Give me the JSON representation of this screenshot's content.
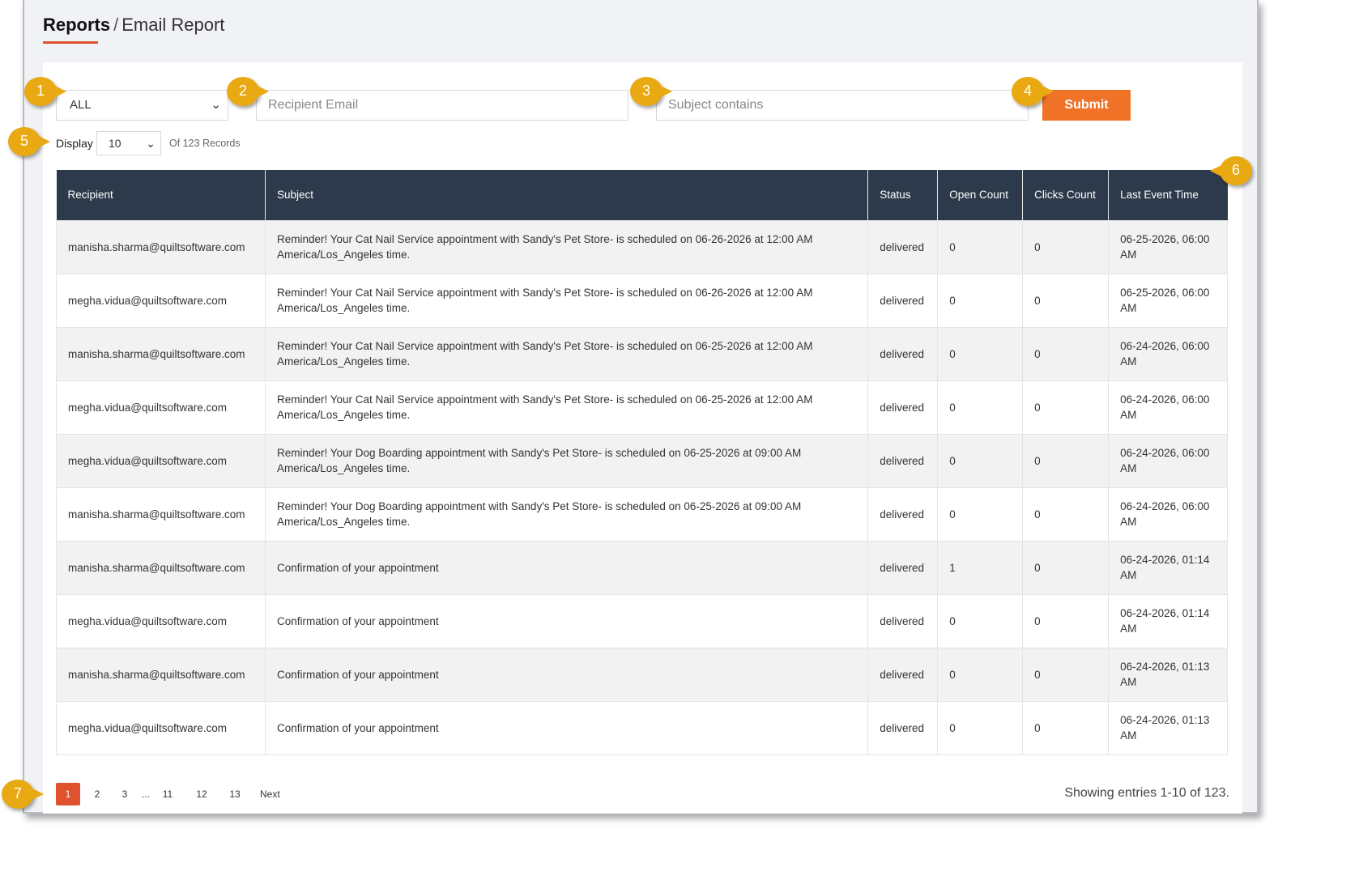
{
  "breadcrumb": {
    "parent": "Reports",
    "separator": "/",
    "current": "Email Report"
  },
  "filters": {
    "status_select": "ALL",
    "recipient_placeholder": "Recipient Email",
    "subject_placeholder": "Subject contains",
    "submit_label": "Submit"
  },
  "display": {
    "label": "Display",
    "page_size": "10",
    "records_text": "Of 123 Records"
  },
  "table": {
    "columns": [
      "Recipient",
      "Subject",
      "Status",
      "Open Count",
      "Clicks Count",
      "Last Event Time"
    ],
    "rows": [
      {
        "recipient": "manisha.sharma@quiltsoftware.com",
        "subject": "Reminder! Your Cat Nail Service appointment with Sandy's Pet Store- is scheduled on 06-26-2026 at 12:00 AM America/Los_Angeles time.",
        "status": "delivered",
        "open": "0",
        "clicks": "0",
        "last": "06-25-2026, 06:00 AM"
      },
      {
        "recipient": "megha.vidua@quiltsoftware.com",
        "subject": "Reminder! Your Cat Nail Service appointment with Sandy's Pet Store- is scheduled on 06-26-2026 at 12:00 AM America/Los_Angeles time.",
        "status": "delivered",
        "open": "0",
        "clicks": "0",
        "last": "06-25-2026, 06:00 AM"
      },
      {
        "recipient": "manisha.sharma@quiltsoftware.com",
        "subject": "Reminder! Your Cat Nail Service appointment with Sandy's Pet Store- is scheduled on 06-25-2026 at 12:00 AM America/Los_Angeles time.",
        "status": "delivered",
        "open": "0",
        "clicks": "0",
        "last": "06-24-2026, 06:00 AM"
      },
      {
        "recipient": "megha.vidua@quiltsoftware.com",
        "subject": "Reminder! Your Cat Nail Service appointment with Sandy's Pet Store- is scheduled on 06-25-2026 at 12:00 AM America/Los_Angeles time.",
        "status": "delivered",
        "open": "0",
        "clicks": "0",
        "last": "06-24-2026, 06:00 AM"
      },
      {
        "recipient": "megha.vidua@quiltsoftware.com",
        "subject": "Reminder! Your Dog Boarding appointment with Sandy's Pet Store- is scheduled on 06-25-2026 at 09:00 AM America/Los_Angeles time.",
        "status": "delivered",
        "open": "0",
        "clicks": "0",
        "last": "06-24-2026, 06:00 AM"
      },
      {
        "recipient": "manisha.sharma@quiltsoftware.com",
        "subject": "Reminder! Your Dog Boarding appointment with Sandy's Pet Store- is scheduled on 06-25-2026 at 09:00 AM America/Los_Angeles time.",
        "status": "delivered",
        "open": "0",
        "clicks": "0",
        "last": "06-24-2026, 06:00 AM"
      },
      {
        "recipient": "manisha.sharma@quiltsoftware.com",
        "subject": "Confirmation of your appointment",
        "status": "delivered",
        "open": "1",
        "clicks": "0",
        "last": "06-24-2026, 01:14 AM"
      },
      {
        "recipient": "megha.vidua@quiltsoftware.com",
        "subject": "Confirmation of your appointment",
        "status": "delivered",
        "open": "0",
        "clicks": "0",
        "last": "06-24-2026, 01:14 AM"
      },
      {
        "recipient": "manisha.sharma@quiltsoftware.com",
        "subject": "Confirmation of your appointment",
        "status": "delivered",
        "open": "0",
        "clicks": "0",
        "last": "06-24-2026, 01:13 AM"
      },
      {
        "recipient": "megha.vidua@quiltsoftware.com",
        "subject": "Confirmation of your appointment",
        "status": "delivered",
        "open": "0",
        "clicks": "0",
        "last": "06-24-2026, 01:13 AM"
      }
    ]
  },
  "pagination": {
    "pages": [
      "1",
      "2",
      "3",
      "...",
      "11",
      "12",
      "13",
      "Next"
    ],
    "active": "1",
    "showing": "Showing entries 1-10 of 123."
  },
  "callouts": [
    "1",
    "2",
    "3",
    "4",
    "5",
    "6",
    "7"
  ],
  "colors": {
    "accent": "#f07227",
    "header_bg": "#2d3a4b",
    "active_page": "#e0512d",
    "callout": "#e8a912"
  }
}
